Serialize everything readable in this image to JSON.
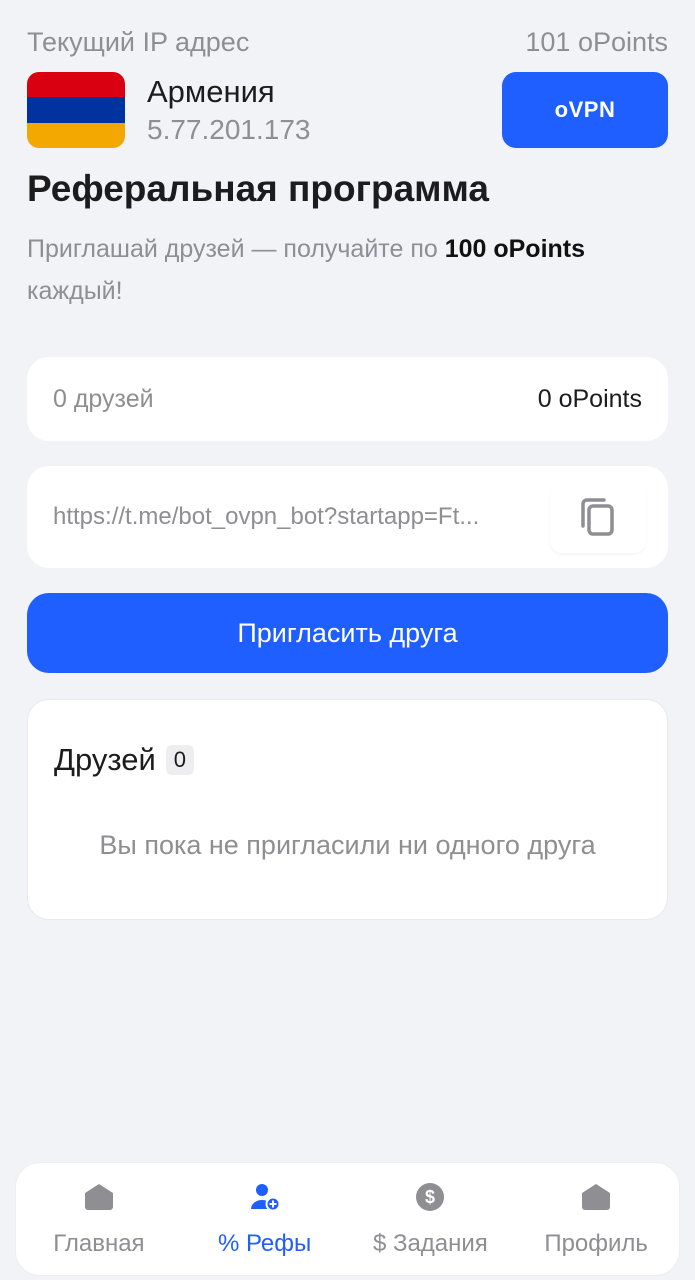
{
  "header": {
    "ip_label": "Текущий IP адрес",
    "balance": "101 oPoints",
    "country": "Армения",
    "ip_address": "5.77.201.173",
    "ovpn_button": "oVPN",
    "flag_colors": [
      "#d90012",
      "#0033a0",
      "#f2a800"
    ]
  },
  "referral": {
    "title": "Реферальная программа",
    "subtitle_pre": "Приглашай друзей — получайте по ",
    "subtitle_bold": "100 oPoints",
    "subtitle_post": " каждый!",
    "friends_count": "0 друзей",
    "points_earned": "0 oPoints",
    "link": "https://t.me/bot_ovpn_bot?startapp=Ft...",
    "invite_button": "Пригласить друга"
  },
  "friends": {
    "title": "Друзей",
    "count": "0",
    "empty_text": "Вы пока не пригласили ни одного друга"
  },
  "tabbar": {
    "items": [
      {
        "label": "Главная",
        "icon": "home-icon",
        "active": false
      },
      {
        "label": "% Рефы",
        "icon": "user-add-icon",
        "active": true
      },
      {
        "label": "$ Задания",
        "icon": "dollar-icon",
        "active": false
      },
      {
        "label": "Профиль",
        "icon": "home-icon",
        "active": false
      }
    ]
  },
  "colors": {
    "accent": "#1f5eff",
    "background": "#f2f3f7",
    "muted_text": "#8e8e93"
  }
}
